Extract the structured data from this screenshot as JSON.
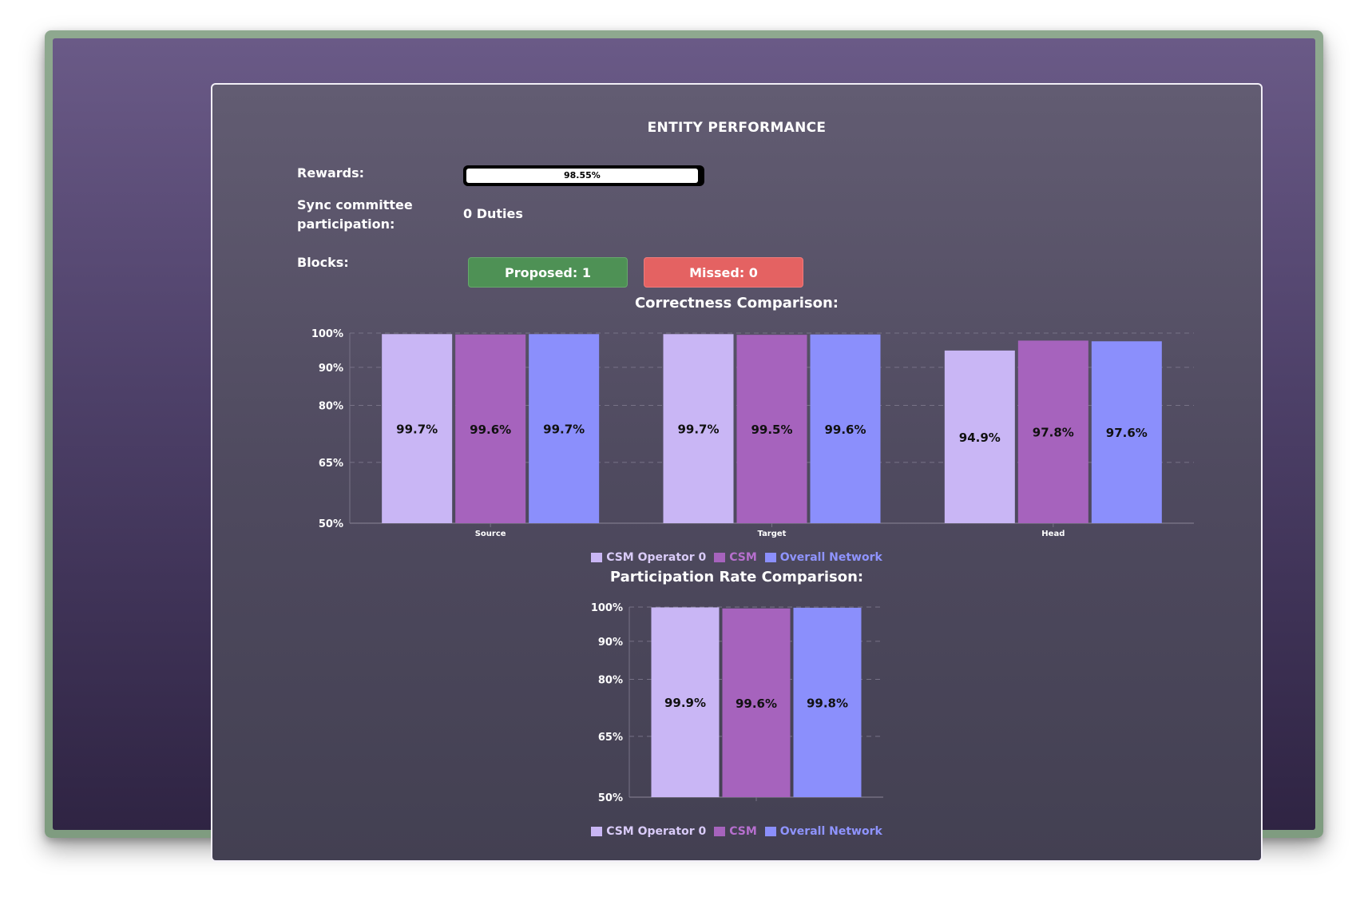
{
  "panel": {
    "title": "ENTITY PERFORMANCE",
    "rewards_label": "Rewards:",
    "rewards_value": "98.55%",
    "rewards_fraction": 0.9855,
    "sync_label": "Sync committee participation:",
    "sync_value": "0 Duties",
    "blocks_label": "Blocks:",
    "proposed_label": "Proposed: 1",
    "missed_label": "Missed: 0"
  },
  "colors": {
    "operator": "#c9b6f5",
    "csm": "#a663bd",
    "network": "#8b8ffc",
    "proposed": "#4e9155",
    "missed": "#e46262"
  },
  "chart_data": [
    {
      "type": "bar",
      "title": "Correctness Comparison:",
      "categories": [
        "Source",
        "Target",
        "Head"
      ],
      "series": [
        {
          "name": "CSM Operator 0",
          "values": [
            99.7,
            99.7,
            94.9
          ],
          "labels": [
            "99.7%",
            "99.7%",
            "94.9%"
          ]
        },
        {
          "name": "CSM",
          "values": [
            99.6,
            99.5,
            97.8
          ],
          "labels": [
            "99.6%",
            "99.5%",
            "97.8%"
          ]
        },
        {
          "name": "Overall Network",
          "values": [
            99.7,
            99.6,
            97.6
          ],
          "labels": [
            "99.7%",
            "99.6%",
            "97.6%"
          ]
        }
      ],
      "yticks": [
        "100%",
        "90%",
        "80%",
        "65%",
        "50%"
      ],
      "ytick_values": [
        100,
        90,
        80,
        65,
        50
      ],
      "ylim": [
        50,
        100
      ],
      "grid": true,
      "legend": "bottom"
    },
    {
      "type": "bar",
      "title": "Participation Rate Comparison:",
      "categories": [
        ""
      ],
      "series": [
        {
          "name": "CSM Operator 0",
          "values": [
            99.9
          ],
          "labels": [
            "99.9%"
          ]
        },
        {
          "name": "CSM",
          "values": [
            99.6
          ],
          "labels": [
            "99.6%"
          ]
        },
        {
          "name": "Overall Network",
          "values": [
            99.8
          ],
          "labels": [
            "99.8%"
          ]
        }
      ],
      "yticks": [
        "100%",
        "90%",
        "80%",
        "65%",
        "50%"
      ],
      "ytick_values": [
        100,
        90,
        80,
        65,
        50
      ],
      "ylim": [
        50,
        100
      ],
      "grid": true,
      "legend": "bottom"
    }
  ]
}
